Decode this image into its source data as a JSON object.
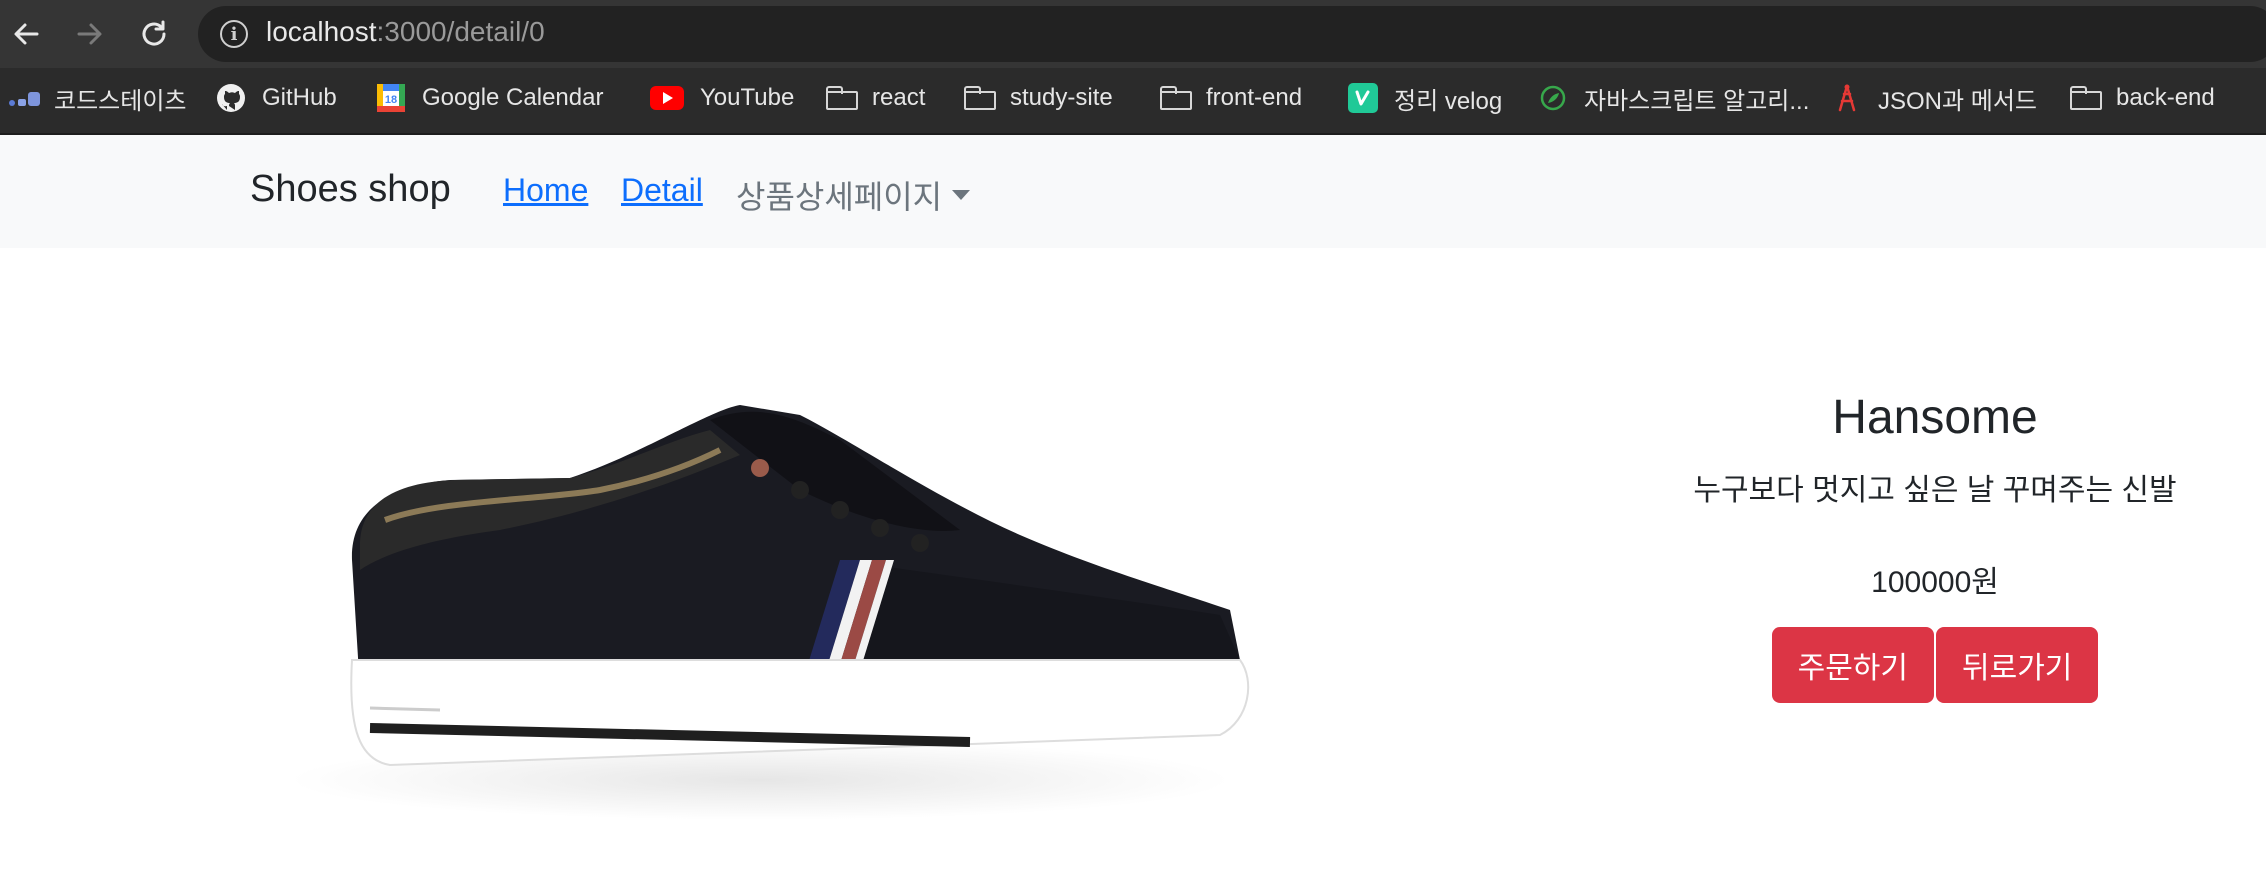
{
  "browser": {
    "url_host": "localhost",
    "url_path": ":3000/detail/0",
    "back_icon": "arrow-left-icon",
    "forward_icon": "arrow-right-icon",
    "reload_icon": "reload-icon"
  },
  "bookmarks": [
    {
      "label": "코드스테이츠",
      "icon": "codestates-icon"
    },
    {
      "label": "GitHub",
      "icon": "github-icon"
    },
    {
      "label": "Google Calendar",
      "icon": "google-calendar-icon"
    },
    {
      "label": "YouTube",
      "icon": "youtube-icon"
    },
    {
      "label": "react",
      "icon": "folder-icon"
    },
    {
      "label": "study-site",
      "icon": "folder-icon"
    },
    {
      "label": "front-end",
      "icon": "folder-icon"
    },
    {
      "label": "정리 velog",
      "icon": "velog-icon"
    },
    {
      "label": "자바스크립트 알고리...",
      "icon": "leaf-icon"
    },
    {
      "label": "JSON과 메서드",
      "icon": "tower-icon"
    },
    {
      "label": "back-end",
      "icon": "folder-icon"
    }
  ],
  "navbar": {
    "brand": "Shoes shop",
    "links": [
      "Home",
      "Detail"
    ],
    "dropdown": "상품상세페이지"
  },
  "product": {
    "title": "Hansome",
    "description": "누구보다 멋지고 싶은 날 꾸며주는 신발",
    "price": "100000원",
    "order_button": "주문하기",
    "back_button": "뒤로가기"
  },
  "colors": {
    "accent": "#dc3545",
    "link": "#0d6efd",
    "navbar_bg": "#f8f9fa"
  }
}
